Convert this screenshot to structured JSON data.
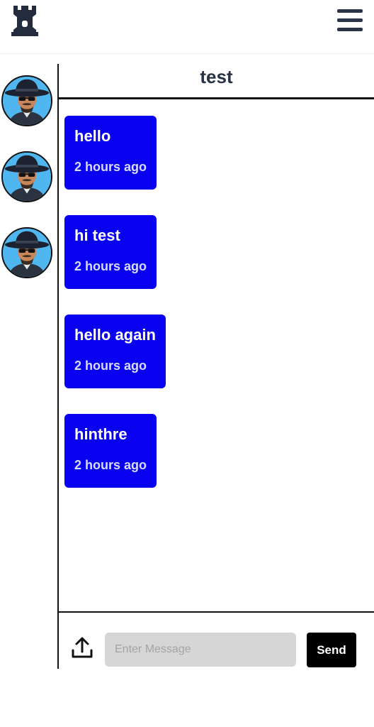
{
  "header": {
    "logo_icon": "chess-rook-icon",
    "menu_icon": "hamburger-menu-icon"
  },
  "sidebar": {
    "avatars": [
      {
        "icon": "user-avatar-icon"
      },
      {
        "icon": "user-avatar-icon"
      },
      {
        "icon": "user-avatar-icon"
      }
    ]
  },
  "chat": {
    "title": "test",
    "messages": [
      {
        "text": "hello",
        "time": "2 hours ago"
      },
      {
        "text": "hi test",
        "time": "2 hours ago"
      },
      {
        "text": "hello again",
        "time": "2 hours ago"
      },
      {
        "text": "hinthre",
        "time": "2 hours ago"
      }
    ],
    "bubble_color": "#0a00f0"
  },
  "composer": {
    "upload_icon": "upload-icon",
    "input_value": "",
    "input_placeholder": "Enter Message",
    "send_label": "Send"
  }
}
